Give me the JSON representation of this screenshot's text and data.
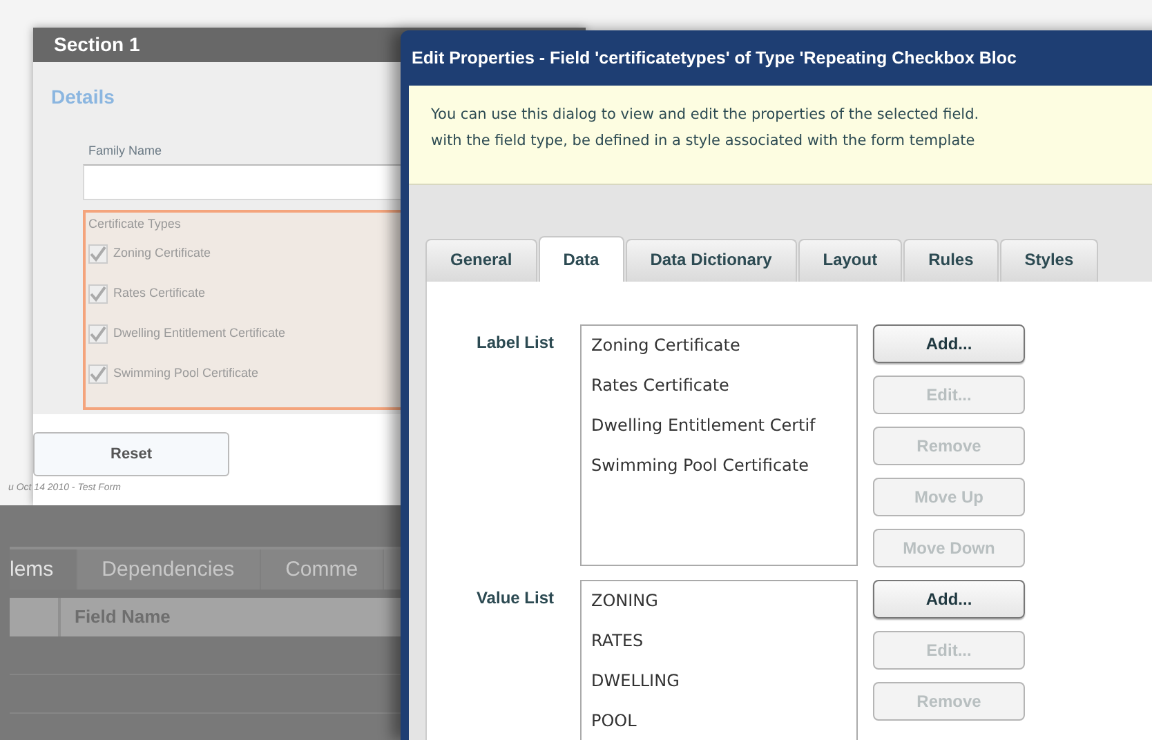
{
  "form": {
    "section_title": "Section 1",
    "heading": "Details",
    "family_name_label": "Family Name",
    "certificate_types": {
      "label": "Certificate Types",
      "items": [
        {
          "label": "Zoning Certificate",
          "checked": true
        },
        {
          "label": "Rates Certificate",
          "checked": true
        },
        {
          "label": "Dwelling Entitlement Certificate",
          "checked": true
        },
        {
          "label": "Swimming Pool Certificate",
          "checked": true
        }
      ]
    },
    "reset_button": "Reset",
    "footer": "u Oct 14 2010 - Test Form"
  },
  "background_panel": {
    "tabs": [
      {
        "label": "lems",
        "selected": true
      },
      {
        "label": "Dependencies",
        "selected": false
      },
      {
        "label": "Comme",
        "selected": false
      }
    ],
    "columns": [
      "Field Name"
    ]
  },
  "dialog": {
    "title": "Edit Properties - Field 'certificatetypes' of Type 'Repeating Checkbox Bloc",
    "info": [
      "You can use this dialog to view and edit the properties of the selected field.",
      "with the field type, be defined in a style associated with the form template"
    ],
    "tabs": [
      {
        "label": "General",
        "selected": false
      },
      {
        "label": "Data",
        "selected": true
      },
      {
        "label": "Data Dictionary",
        "selected": false
      },
      {
        "label": "Layout",
        "selected": false
      },
      {
        "label": "Rules",
        "selected": false
      },
      {
        "label": "Styles",
        "selected": false
      }
    ],
    "lists": [
      {
        "label": "Label List",
        "items": [
          "Zoning Certificate",
          "Rates Certificate",
          "Dwelling Entitlement Certif",
          "Swimming Pool Certificate"
        ],
        "buttons": [
          {
            "label": "Add...",
            "disabled": false
          },
          {
            "label": "Edit...",
            "disabled": true
          },
          {
            "label": "Remove",
            "disabled": true
          },
          {
            "label": "Move Up",
            "disabled": true
          },
          {
            "label": "Move Down",
            "disabled": true
          }
        ]
      },
      {
        "label": "Value List",
        "items": [
          "ZONING",
          "RATES",
          "DWELLING",
          "POOL"
        ],
        "buttons": [
          {
            "label": "Add...",
            "disabled": false
          },
          {
            "label": "Edit...",
            "disabled": true
          },
          {
            "label": "Remove",
            "disabled": true
          }
        ]
      }
    ]
  }
}
